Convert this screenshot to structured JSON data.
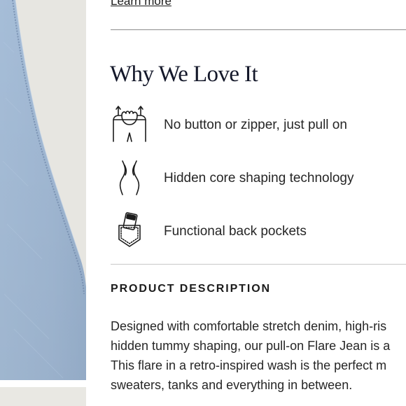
{
  "product_image": {
    "alt_icon": "denim-flare-jean-photo",
    "denim_color": "#a8c0da",
    "background_color": "#e7e6e1"
  },
  "learn_more": {
    "label": "Learn more"
  },
  "why_we_love_it": {
    "title": "Why We Love It",
    "features": [
      {
        "icon": "pull-on-waistband-icon",
        "label": "No button or zipper, just pull on"
      },
      {
        "icon": "core-shaping-icon",
        "label": "Hidden core shaping technology"
      },
      {
        "icon": "back-pocket-icon",
        "label": "Functional back pockets"
      }
    ]
  },
  "product_description": {
    "heading": "PRODUCT DESCRIPTION",
    "lines": [
      "Designed with comfortable stretch denim, high-ris",
      "hidden tummy shaping, our pull-on Flare Jean is a",
      "This flare in a retro-inspired wash is the perfect m",
      "sweaters, tanks and everything in between."
    ]
  },
  "colors": {
    "text": "#1b1b1b",
    "title": "#14182a",
    "divider": "#8c8c8c"
  }
}
